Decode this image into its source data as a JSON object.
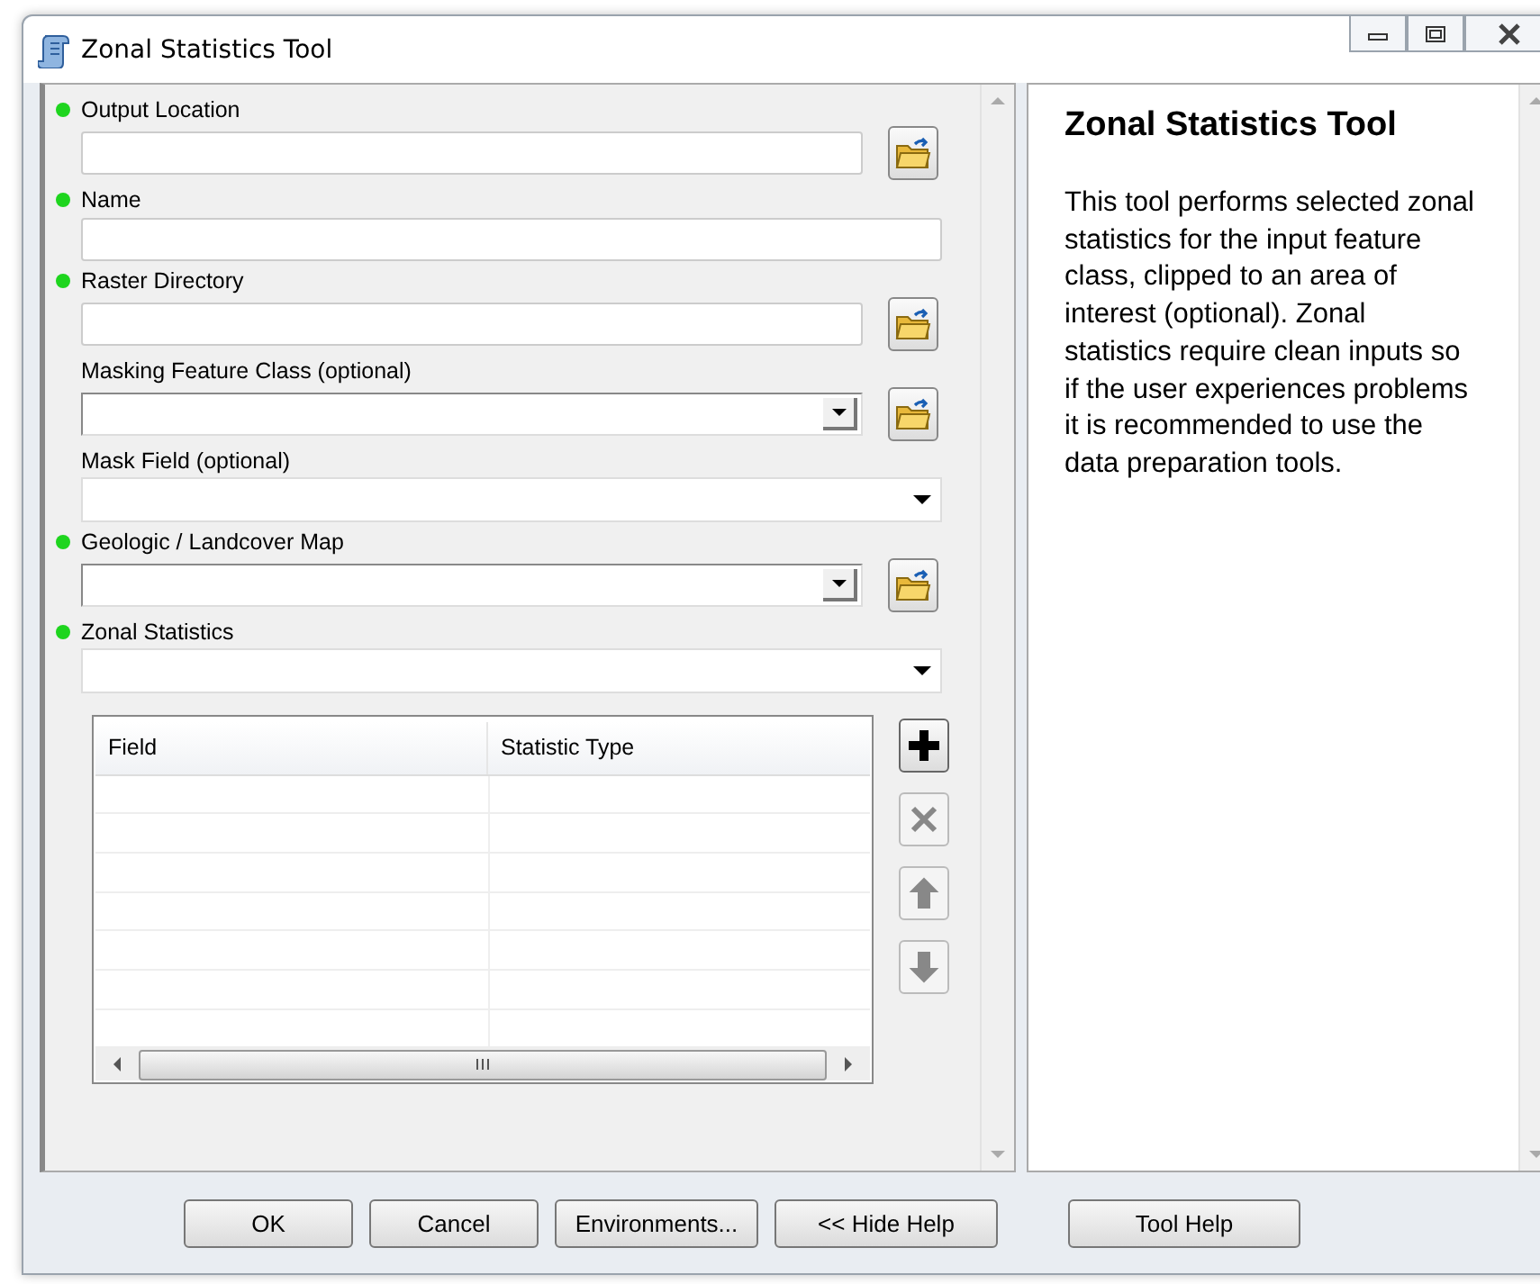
{
  "window": {
    "title": "Zonal Statistics Tool"
  },
  "parameters": [
    {
      "label": "Output Location",
      "required": true,
      "kind": "text-browse"
    },
    {
      "label": "Name",
      "required": true,
      "kind": "text"
    },
    {
      "label": "Raster Directory",
      "required": true,
      "kind": "text-browse"
    },
    {
      "label": "Masking Feature Class (optional)",
      "required": false,
      "kind": "combo-browse"
    },
    {
      "label": "Mask Field (optional)",
      "required": false,
      "kind": "dropdown"
    },
    {
      "label": "Geologic / Landcover Map",
      "required": true,
      "kind": "combo-browse"
    },
    {
      "label": "Zonal Statistics",
      "required": true,
      "kind": "dropdown"
    }
  ],
  "table": {
    "columns": [
      "Field",
      "Statistic Type"
    ]
  },
  "table_buttons": [
    {
      "kind": "add",
      "disabled": false
    },
    {
      "kind": "delete",
      "disabled": true
    },
    {
      "kind": "up",
      "disabled": true
    },
    {
      "kind": "down",
      "disabled": true
    }
  ],
  "help": {
    "title": "Zonal Statistics Tool",
    "text": "This tool performs selected zonal statistics for the input feature class, clipped to an area of interest (optional). Zonal statistics require clean inputs so if the user experiences problems it is recommended to use the data preparation tools."
  },
  "buttons": [
    "OK",
    "Cancel",
    "Environments...",
    "<< Hide Help",
    "Tool Help"
  ]
}
